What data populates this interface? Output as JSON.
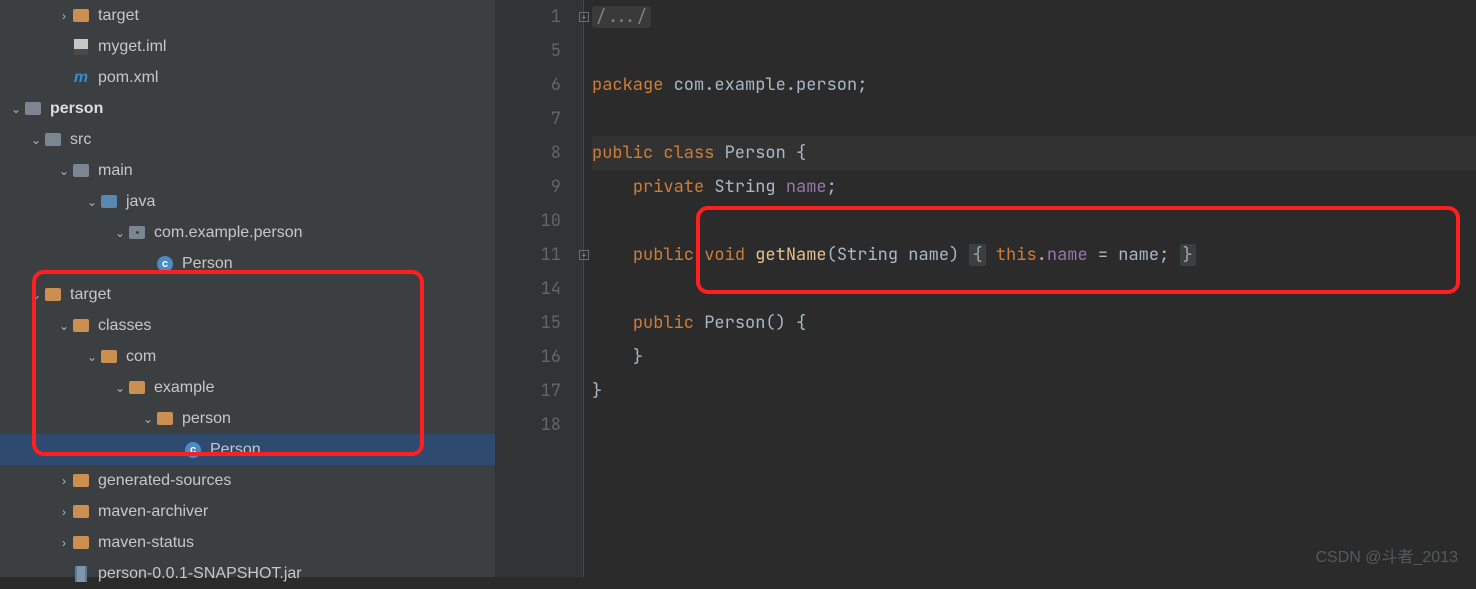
{
  "tree": {
    "target0": "target",
    "iml": "myget.iml",
    "pom": "pom.xml",
    "person": "person",
    "src": "src",
    "main": "main",
    "java": "java",
    "pkg": "com.example.person",
    "cls": "Person",
    "target": "target",
    "classes": "classes",
    "com": "com",
    "example": "example",
    "personPkg": "person",
    "cls2": "Person",
    "gensrc": "generated-sources",
    "archiver": "maven-archiver",
    "status": "maven-status",
    "jar": "person-0.0.1-SNAPSHOT.jar"
  },
  "gutter": [
    "1",
    "5",
    "6",
    "7",
    "8",
    "9",
    "10",
    "11",
    "14",
    "15",
    "16",
    "17",
    "18"
  ],
  "code": {
    "l1fold": "/.../",
    "l6_kw": "package",
    "l6_rest": " com.example.person;",
    "l8_kw1": "public",
    "l8_kw2": "class",
    "l8_name": "Person",
    "l8_rest": " {",
    "l9_kw": "private",
    "l9_type": "String",
    "l9_name": "name",
    "l9_rest": ";",
    "l11_kw1": "public",
    "l11_kw2": "void",
    "l11_mn": "getName",
    "l11_args": "(String name)",
    "l11_b1": "{",
    "l11_this": "this",
    "l11_dot": ".",
    "l11_fld": "name",
    "l11_assign": " = name; ",
    "l11_b2": "}",
    "l15_kw": "public",
    "l15_ctor": "Person",
    "l15_rest": "() {",
    "l16": "}",
    "l17": "}"
  },
  "watermark": "CSDN @斗者_2013"
}
